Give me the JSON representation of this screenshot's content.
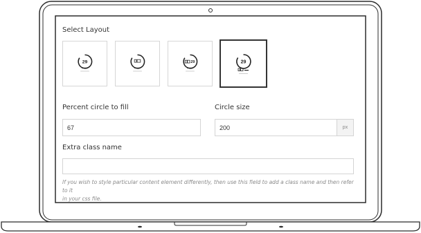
{
  "form": {
    "select_layout_label": "Select Layout",
    "layouts": [
      {
        "number_label": "29",
        "has_icon": false,
        "selected": false
      },
      {
        "number_label": "",
        "has_icon": true,
        "selected": false
      },
      {
        "number_label": "29",
        "has_icon": true,
        "selected": false
      },
      {
        "number_label": "29",
        "has_icon": true,
        "selected": true
      }
    ],
    "percent_label": "Percent circle to fill",
    "percent_value": "67",
    "circle_size_label": "Circle size",
    "circle_size_value": "200",
    "circle_size_unit": "px",
    "extra_class_label": "Extra class name",
    "extra_class_value": "",
    "help_line1": "If you wish to style particular content element differently, then use this field to add a class name and then refer to it",
    "help_line2": "in your css file."
  }
}
